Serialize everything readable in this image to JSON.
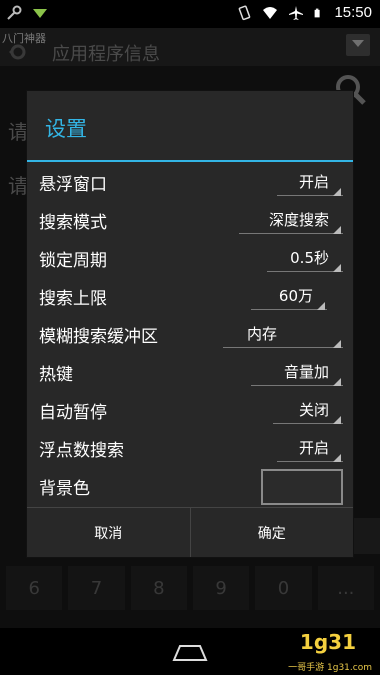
{
  "status_bar": {
    "time": "15:50",
    "left_icons": [
      "tool-icon",
      "email-icon"
    ],
    "right_icons": [
      "vibrate-icon",
      "wifi-icon",
      "airplane-icon",
      "battery-icon"
    ]
  },
  "background_app": {
    "app_name": "八门神器",
    "header_title": "应用程序信息",
    "row_label_1": "请",
    "row_label_2": "请",
    "keypad": [
      "6",
      "7",
      "8",
      "9",
      "0",
      "..."
    ]
  },
  "dialog": {
    "title": "设置",
    "settings": [
      {
        "label": "悬浮窗口",
        "value": "开启"
      },
      {
        "label": "搜索模式",
        "value": "深度搜索"
      },
      {
        "label": "锁定周期",
        "value": "0.5秒"
      },
      {
        "label": "搜索上限",
        "value": "60万"
      },
      {
        "label": "模糊搜索缓冲区",
        "value": "内存"
      },
      {
        "label": "热键",
        "value": "音量加"
      },
      {
        "label": "自动暂停",
        "value": "关闭"
      },
      {
        "label": "浮点数搜索",
        "value": "开启"
      }
    ],
    "background_color_label": "背景色",
    "cancel_label": "取消",
    "confirm_label": "确定"
  },
  "colors": {
    "accent": "#33b5e5",
    "dialog_bg": "#282828",
    "watermark": "#f4d03f"
  },
  "watermark": {
    "logo": "1g31",
    "text": "一哥手游 1g31.com"
  }
}
